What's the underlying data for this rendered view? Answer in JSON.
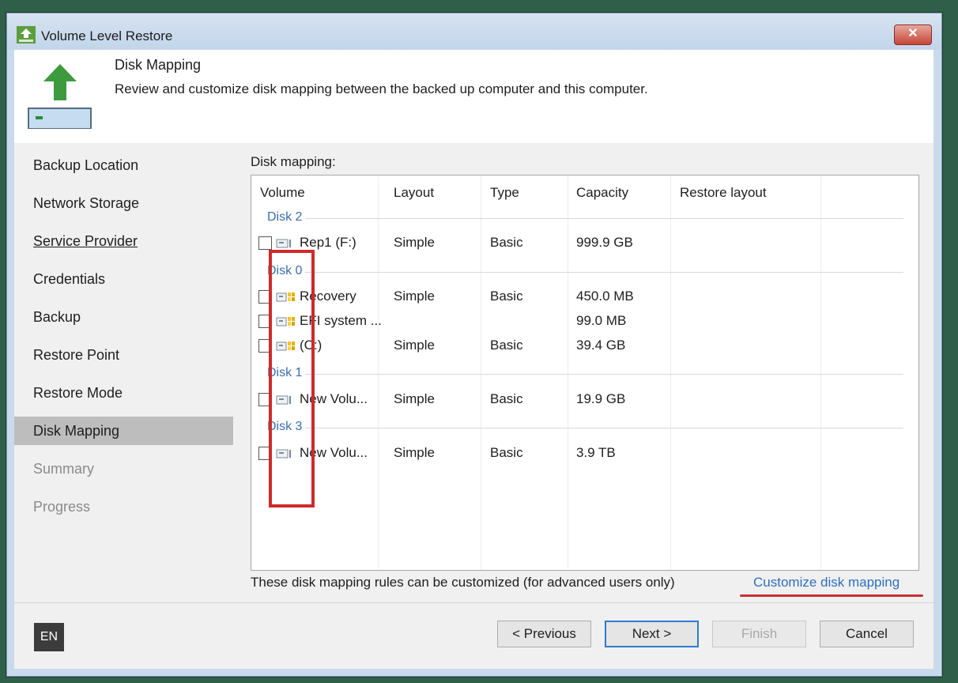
{
  "window": {
    "title": "Volume Level Restore",
    "close_label": "✕"
  },
  "header": {
    "title": "Disk Mapping",
    "description": "Review and customize disk mapping between the backed up computer and this computer."
  },
  "sidebar": {
    "items": [
      {
        "label": "Backup Location",
        "state": "normal"
      },
      {
        "label": "Network Storage",
        "state": "normal"
      },
      {
        "label": "Service Provider",
        "state": "underline"
      },
      {
        "label": "Credentials",
        "state": "normal"
      },
      {
        "label": "Backup",
        "state": "normal"
      },
      {
        "label": "Restore Point",
        "state": "normal"
      },
      {
        "label": "Restore Mode",
        "state": "normal"
      },
      {
        "label": "Disk Mapping",
        "state": "active"
      },
      {
        "label": "Summary",
        "state": "disabled"
      },
      {
        "label": "Progress",
        "state": "disabled"
      }
    ]
  },
  "content": {
    "label": "Disk mapping:",
    "columns": [
      "Volume",
      "Layout",
      "Type",
      "Capacity",
      "Restore layout"
    ],
    "groups": [
      {
        "label": "Disk 2",
        "rows": [
          {
            "volume": "Rep1 (F:)",
            "layout": "Simple",
            "type": "Basic",
            "capacity": "999.9 GB",
            "restore_layout": "",
            "icon": "drive-icon"
          }
        ]
      },
      {
        "label": "Disk 0",
        "rows": [
          {
            "volume": "Recovery",
            "layout": "Simple",
            "type": "Basic",
            "capacity": "450.0 MB",
            "restore_layout": "",
            "icon": "system-drive-icon"
          },
          {
            "volume": "EFI system ...",
            "layout": "",
            "type": "",
            "capacity": "99.0 MB",
            "restore_layout": "",
            "icon": "system-drive-icon"
          },
          {
            "volume": "(C:)",
            "layout": "Simple",
            "type": "Basic",
            "capacity": "39.4 GB",
            "restore_layout": "",
            "icon": "system-drive-icon"
          }
        ]
      },
      {
        "label": "Disk 1",
        "rows": [
          {
            "volume": "New Volu...",
            "layout": "Simple",
            "type": "Basic",
            "capacity": "19.9 GB",
            "restore_layout": "",
            "icon": "drive-icon"
          }
        ]
      },
      {
        "label": "Disk 3",
        "rows": [
          {
            "volume": "New Volu...",
            "layout": "Simple",
            "type": "Basic",
            "capacity": "3.9 TB",
            "restore_layout": "",
            "icon": "drive-icon"
          }
        ]
      }
    ],
    "footer_note": "These disk mapping rules can be customized (for advanced users only)",
    "customize_link": "Customize disk mapping"
  },
  "bottom": {
    "language": "EN",
    "previous": "< Previous",
    "next": "Next >",
    "finish": "Finish",
    "cancel": "Cancel"
  },
  "colors": {
    "accent": "#2e7bd0",
    "link": "#2f6fbf",
    "annotation": "#cf2a2a",
    "group_label": "#3a6db0"
  }
}
